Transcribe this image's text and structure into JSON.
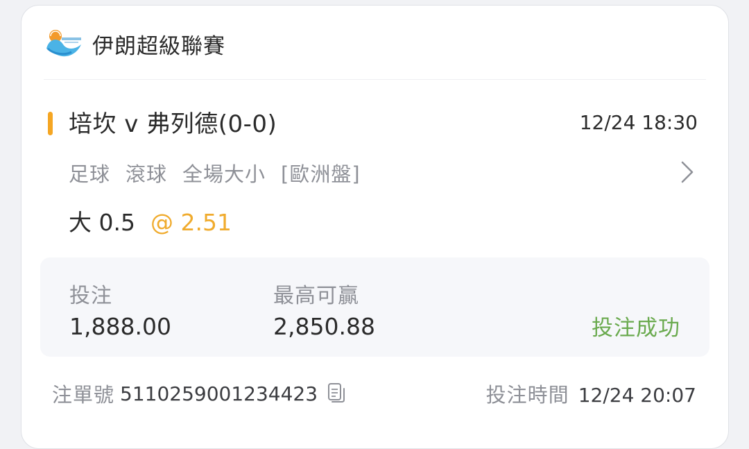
{
  "league": {
    "logo_icon": "league-logo-icon",
    "name": "伊朗超級聯賽"
  },
  "match": {
    "title": "培坎 v 弗列德(0-0)",
    "time": "12/24 18:30",
    "sport": "足球",
    "bet_type": "滾球",
    "market": "全場大小",
    "odds_format": "[歐洲盤]",
    "selection": "大 0.5",
    "odds": "@ 2.51"
  },
  "stake": {
    "stake_label": "投注",
    "stake_value": "1,888.00",
    "max_win_label": "最高可贏",
    "max_win_value": "2,850.88",
    "status": "投注成功"
  },
  "footer": {
    "ticket_label": "注單號",
    "ticket_number": "5110259001234423",
    "bet_time_label": "投注時間",
    "bet_time": "12/24 20:07"
  },
  "colors": {
    "accent": "#f5a623",
    "odds": "#f0ab2d",
    "success": "#6aaa4e",
    "text_primary": "#2b2b2b",
    "text_secondary": "#8e9097"
  },
  "icons": {
    "chevron": "chevron-right-icon",
    "copy": "copy-icon"
  }
}
